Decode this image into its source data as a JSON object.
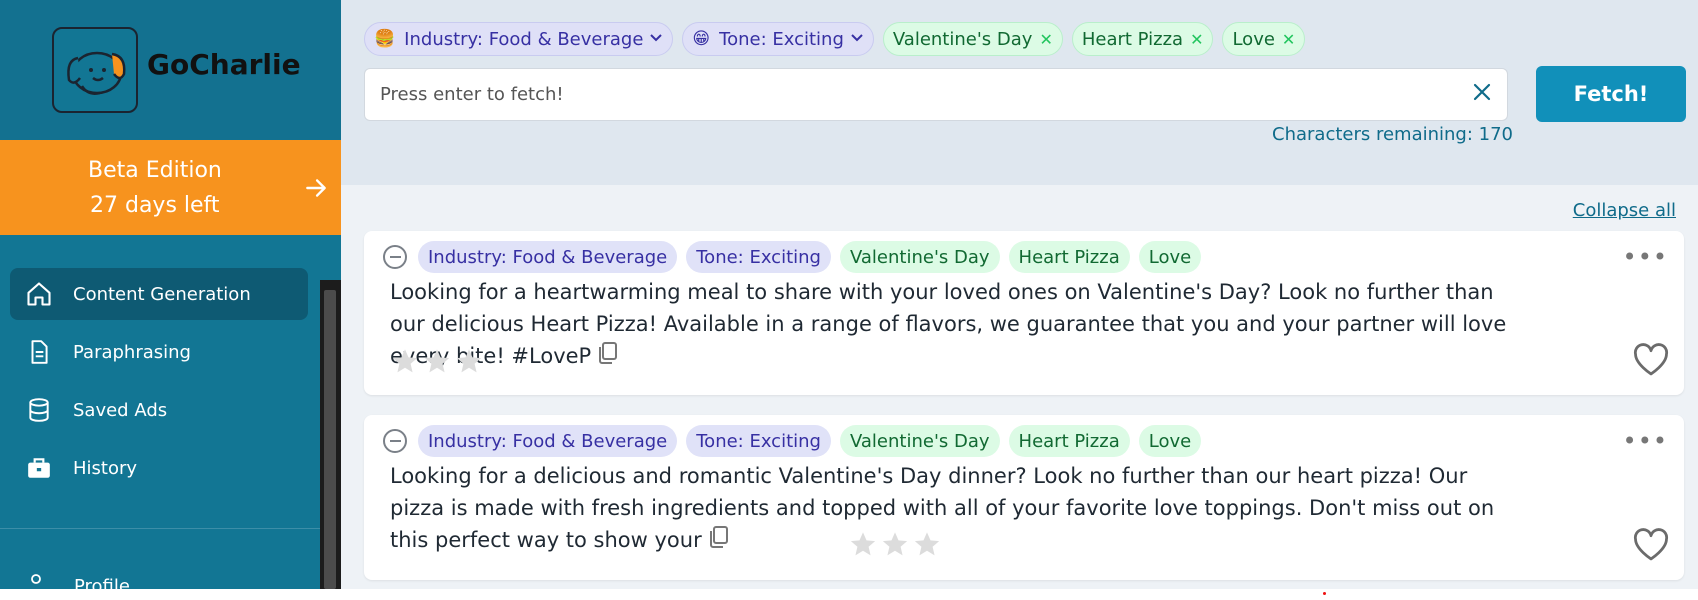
{
  "sidebar": {
    "brand": "GoCharlie",
    "beta": {
      "line1": "Beta Edition",
      "line2": "27 days left"
    },
    "nav": [
      {
        "label": "Content Generation",
        "icon": "home-icon",
        "active": true
      },
      {
        "label": "Paraphrasing",
        "icon": "document-icon",
        "active": false
      },
      {
        "label": "Saved Ads",
        "icon": "database-icon",
        "active": false
      },
      {
        "label": "History",
        "icon": "briefcase-icon",
        "active": false
      }
    ],
    "profile": "Profile"
  },
  "filters": {
    "industry": {
      "emoji": "🍔",
      "label": "Industry: Food & Beverage"
    },
    "tone": {
      "emoji": "😁",
      "label": "Tone: Exciting"
    },
    "keywords": [
      "Valentine's Day",
      "Heart Pizza",
      "Love"
    ]
  },
  "search": {
    "placeholder": "Press enter to fetch!",
    "value": ""
  },
  "fetch_label": "Fetch!",
  "remaining": "Characters remaining: 170",
  "collapse_label": "Collapse all",
  "results": [
    {
      "tags": [
        "Industry: Food & Beverage",
        "Tone: Exciting",
        "Valentine's Day",
        "Heart Pizza",
        "Love"
      ],
      "text": "Looking for a heartwarming meal to share with your loved ones on Valentine's Day? Look no further than our delicious Heart Pizza! Available in a range of flavors, we guarantee that you and your partner will love every bite! #LoveP",
      "rating": 0
    },
    {
      "tags": [
        "Industry: Food & Beverage",
        "Tone: Exciting",
        "Valentine's Day",
        "Heart Pizza",
        "Love"
      ],
      "text": "Looking for a delicious and romantic Valentine's Day dinner? Look no further than our heart pizza! Our pizza is made with fresh ingredients and topped with all of your favorite love toppings. Don't miss out on this perfect way to show your",
      "rating": 0
    }
  ],
  "colors": {
    "sidebar": "#127694",
    "beta": "#f7931e",
    "accent": "#1190ba",
    "indigo_chip": "#e0e2f8",
    "green_chip": "#dcfbe5"
  }
}
